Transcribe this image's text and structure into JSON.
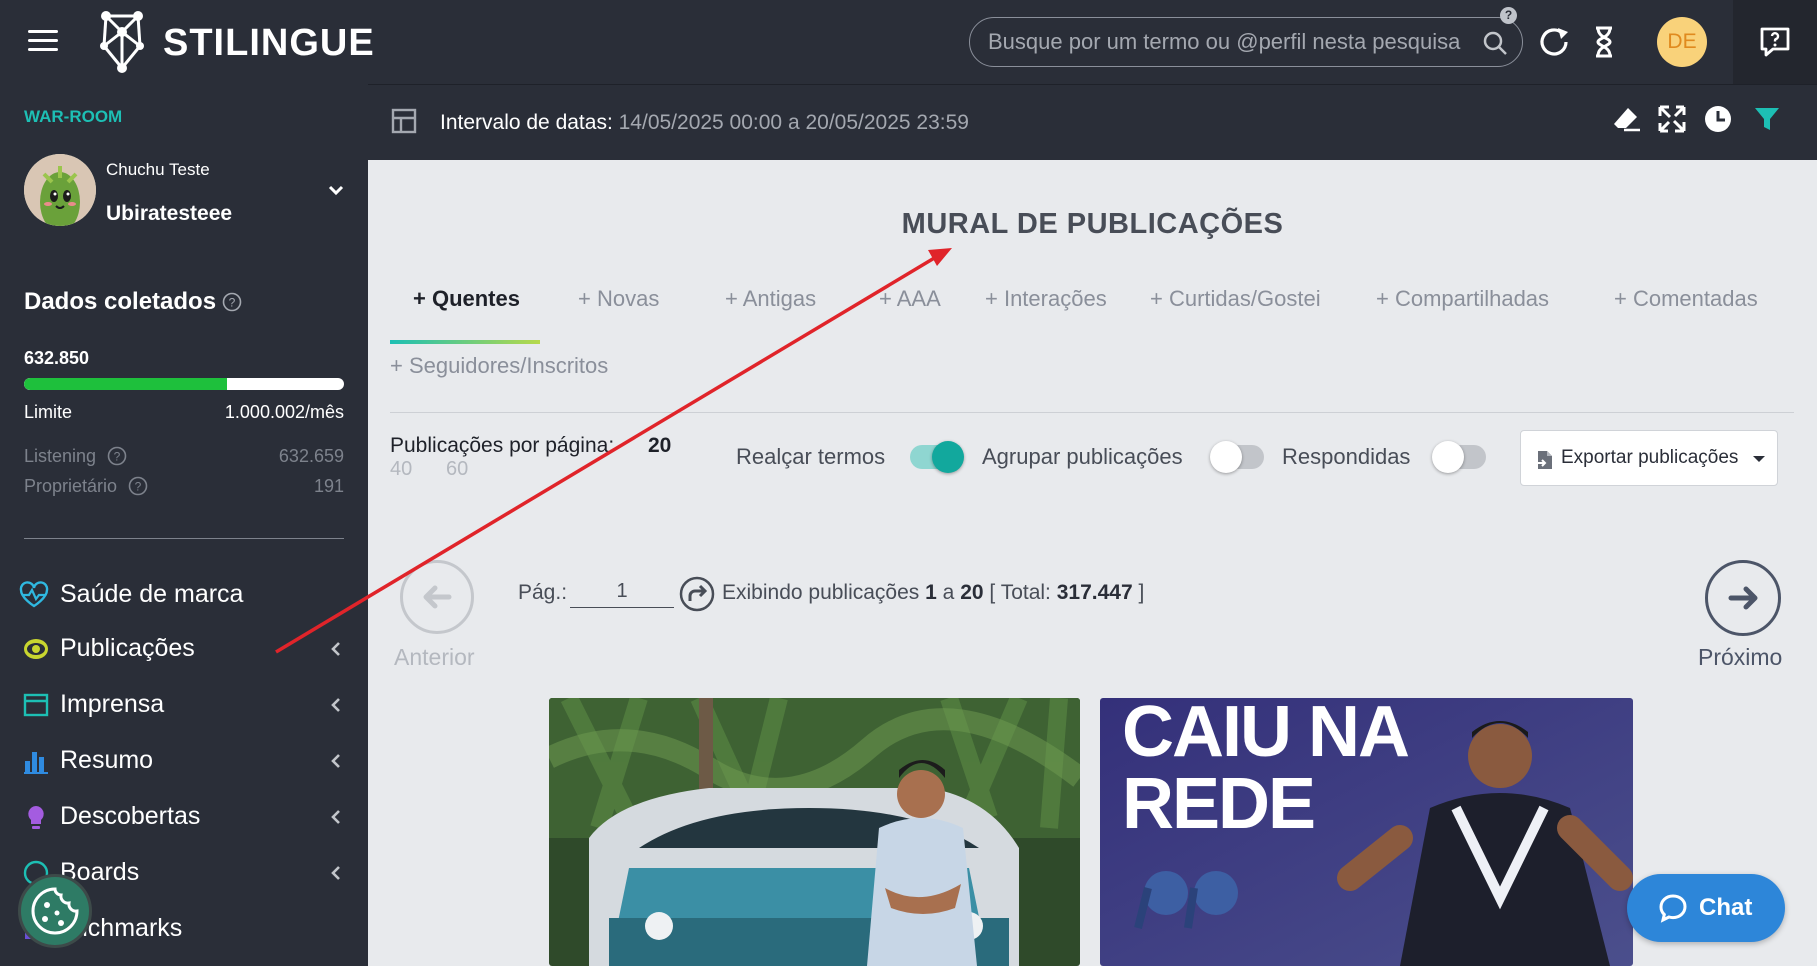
{
  "app": {
    "logo_text": "STILINGUE",
    "search_placeholder": "Busque por um termo ou @perfil nesta pesquisa",
    "help_badge": "?",
    "avatar_initials": "DE"
  },
  "sidebar": {
    "section": "WAR-ROOM",
    "profile": {
      "name_small": "Chuchu Teste",
      "name_big": "Ubiratesteee"
    },
    "dados": {
      "title": "Dados coletados",
      "value": "632.850",
      "progress_fraction": 0.633,
      "limit_label": "Limite",
      "limit_value": "1.000.002/mês",
      "listening_label": "Listening",
      "listening_value": "632.659",
      "owner_label": "Proprietário",
      "owner_value": "191"
    },
    "nav": [
      {
        "label": "Saúde de marca",
        "icon": "heart-pulse-icon"
      },
      {
        "label": "Publicações",
        "icon": "eye-icon"
      },
      {
        "label": "Imprensa",
        "icon": "newspaper-icon"
      },
      {
        "label": "Resumo",
        "icon": "bar-chart-icon"
      },
      {
        "label": "Descobertas",
        "icon": "lightbulb-icon"
      },
      {
        "label": "Boards",
        "icon": "palette-icon"
      },
      {
        "label": "enchmarks",
        "icon": "benchmark-icon"
      }
    ]
  },
  "datebar": {
    "label": "Intervalo de datas:",
    "value": "14/05/2025 00:00 a 20/05/2025 23:59"
  },
  "main": {
    "title": "MURAL DE PUBLICAÇÕES",
    "tabs": [
      "+ Quentes",
      "+ Novas",
      "+ Antigas",
      "+ AAA",
      "+ Interações",
      "+ Curtidas/Gostei",
      "+ Compartilhadas",
      "+ Comentadas",
      "+ Seguidores/Inscritos"
    ],
    "active_tab": "+ Quentes",
    "per_page_label": "Publicações por página:",
    "per_page_value": "20",
    "per_page_options": [
      "40",
      "60"
    ],
    "toggles": [
      {
        "label": "Realçar termos",
        "on": true
      },
      {
        "label": "Agrupar publicações",
        "on": false
      },
      {
        "label": "Respondidas",
        "on": false
      }
    ],
    "export_label": "Exportar publicações",
    "pagination": {
      "prev": "Anterior",
      "next": "Próximo",
      "page_label": "Pág.:",
      "page_value": "1",
      "showing_prefix": "Exibindo publicações",
      "from": "1",
      "connector": "a",
      "to": "20",
      "total_prefix": "[ Total:",
      "total": "317.447",
      "total_suffix": "]"
    },
    "cards": [
      {
        "caption": ""
      },
      {
        "caption_line1": "CAIU NA",
        "caption_line2": "REDE"
      }
    ]
  },
  "chat": {
    "label": "Chat"
  },
  "colors": {
    "accent": "#1dbfb4",
    "progress": "#1ec03c",
    "annotation_arrow": "#e0242a"
  }
}
